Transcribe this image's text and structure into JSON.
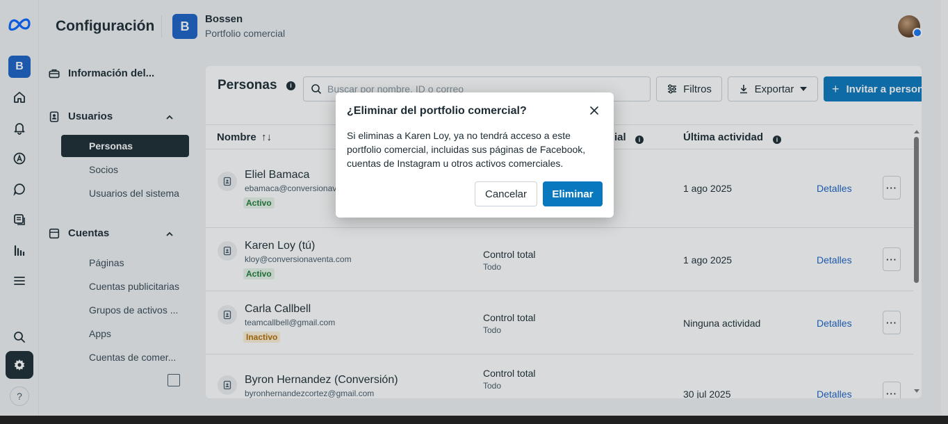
{
  "header": {
    "title": "Configuración",
    "portfolio_initial": "B",
    "portfolio_name": "Bossen",
    "portfolio_type": "Portfolio comercial"
  },
  "rail": {
    "business_initial": "B",
    "help_label": "?"
  },
  "sidebar": {
    "business_info": "Información del...",
    "users_section": "Usuarios",
    "users_items": [
      "Personas",
      "Socios",
      "Usuarios del sistema"
    ],
    "accounts_section": "Cuentas",
    "accounts_items": [
      "Páginas",
      "Cuentas publicitarias",
      "Grupos de activos ...",
      "Apps",
      "Cuentas de comer..."
    ]
  },
  "main": {
    "section_title": "Personas",
    "search_placeholder": "Buscar por nombre, ID o correo",
    "filters_label": "Filtros",
    "export_label": "Exportar",
    "invite_label": "Invitar a persona",
    "columns": {
      "name": "Nombre",
      "sort": "↑↓",
      "access_fragment": "ial",
      "last_activity": "Última actividad"
    },
    "details_label": "Detalles",
    "rows": [
      {
        "name": "Eliel Bamaca",
        "email": "ebamaca@conversionave",
        "status": "Activo",
        "permission": "",
        "permission_sub": "",
        "last_activity": "1 ago 2025"
      },
      {
        "name": "Karen Loy (tú)",
        "email": "kloy@conversionaventa.com",
        "status": "Activo",
        "permission": "Control total",
        "permission_sub": "Todo",
        "last_activity": "1 ago 2025"
      },
      {
        "name": "Carla Callbell",
        "email": "teamcallbell@gmail.com",
        "status": "Inactivo",
        "permission": "Control total",
        "permission_sub": "Todo",
        "last_activity": "Ninguna actividad"
      },
      {
        "name": "Byron Hernandez (Conversión)",
        "email": "byronhernandezcortez@gmail.com",
        "status": "",
        "permission": "Control total",
        "permission_sub": "Todo",
        "last_activity": "30 jul 2025"
      }
    ]
  },
  "modal": {
    "title": "¿Eliminar del portfolio comercial?",
    "body": "Si eliminas a Karen Loy, ya no tendrá acceso a este portfolio comercial, incluidas sus páginas de Facebook, cuentas de Instagram u otros activos comerciales.",
    "cancel_label": "Cancelar",
    "confirm_label": "Eliminar"
  },
  "colors": {
    "primary": "#0a78be",
    "brand_blue": "#1a62c7",
    "active_green": "#1e7a34",
    "inactive_orange": "#b36b00"
  }
}
